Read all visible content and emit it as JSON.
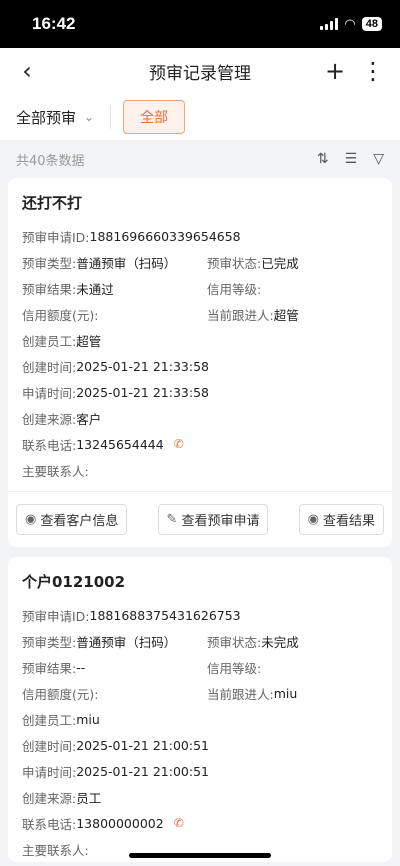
{
  "status": {
    "time": "16:42",
    "battery": "48"
  },
  "nav": {
    "title": "预审记录管理"
  },
  "filter": {
    "dropdown_label": "全部预审",
    "chip_label": "全部"
  },
  "list": {
    "count_text": "共40条数据"
  },
  "cards": [
    {
      "title": "还打不打",
      "id_label": "预审申请ID:",
      "id_value": "1881696660339654658",
      "type_label": "预审类型:",
      "type_value": "普通预审（扫码）",
      "status_label": "预审状态:",
      "status_value": "已完成",
      "result_label": "预审结果:",
      "result_value": "未通过",
      "grade_label": "信用等级:",
      "grade_value": "",
      "limit_label": "信用额度(元):",
      "limit_value": "",
      "follower_label": "当前跟进人:",
      "follower_value": "超管",
      "creator_label": "创建员工:",
      "creator_value": "超管",
      "created_label": "创建时间:",
      "created_value": "2025-01-21 21:33:58",
      "applied_label": "申请时间:",
      "applied_value": "2025-01-21 21:33:58",
      "source_label": "创建来源:",
      "source_value": "客户",
      "phone_label": "联系电话:",
      "phone_value": "13245654444",
      "contact_label": "主要联系人:",
      "contact_value": "",
      "btn_customer": "查看客户信息",
      "btn_apply": "查看预审申请",
      "btn_result": "查看结果"
    },
    {
      "title": "个户0121002",
      "id_label": "预审申请ID:",
      "id_value": "1881688375431626753",
      "type_label": "预审类型:",
      "type_value": "普通预审（扫码）",
      "status_label": "预审状态:",
      "status_value": "未完成",
      "result_label": "预审结果:",
      "result_value": "--",
      "grade_label": "信用等级:",
      "grade_value": "",
      "limit_label": "信用额度(元):",
      "limit_value": "",
      "follower_label": "当前跟进人:",
      "follower_value": "miu",
      "creator_label": "创建员工:",
      "creator_value": "miu",
      "created_label": "创建时间:",
      "created_value": "2025-01-21 21:00:51",
      "applied_label": "申请时间:",
      "applied_value": "2025-01-21 21:00:51",
      "source_label": "创建来源:",
      "source_value": "员工",
      "phone_label": "联系电话:",
      "phone_value": "13800000002",
      "contact_label": "主要联系人:",
      "contact_value": ""
    }
  ]
}
